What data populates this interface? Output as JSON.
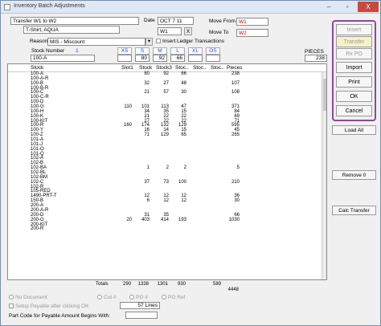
{
  "window": {
    "title": "Inventory Batch Adjustments",
    "close_label": "X",
    "min_label": "–"
  },
  "header": {
    "transfer_desc": "Transfer W1 to W2",
    "item_desc": "T-Shirt, AQUA",
    "date_label": "Date",
    "date_value": "OCT 7 11",
    "warehouse": "W1",
    "move_from_label": "Move From",
    "move_from_value": "W1",
    "move_to_label": "Move To",
    "move_to_value": "W2",
    "x_button": "X"
  },
  "reason": {
    "label": "Reason",
    "value": "MIS - Miscount",
    "insert_ledger_label": "Insert Ledger Transactions"
  },
  "stock_entry": {
    "label": "Stock Number",
    "number": "1",
    "value": "100-A",
    "pieces_label": "PIECES",
    "pieces_value": "238"
  },
  "sizes": [
    "XS",
    "S",
    "M",
    "L",
    "XL",
    "OS"
  ],
  "entry_qtys": [
    "",
    "80",
    "92",
    "66",
    "",
    ""
  ],
  "actions": {
    "insert": "Insert",
    "transfer": "Transfer",
    "rx_po": "Rx PO",
    "import": "Import",
    "print": "Print",
    "ok": "OK",
    "cancel": "Cancel",
    "load_all": "Load All",
    "remove_0": "Remove 0",
    "calc_transfer": "Calc Transfer"
  },
  "grid": {
    "columns": [
      "Stock",
      "Slot1",
      "Stock",
      "Stock3",
      "Stoc..",
      "Stoc..",
      "Stoc..",
      "Pieces"
    ],
    "rows": [
      [
        "100-A",
        "",
        "80",
        "92",
        "66",
        "",
        "",
        "238"
      ],
      [
        "100-A-R",
        "",
        "",
        "",
        "",
        "",
        "",
        ""
      ],
      [
        "100-B",
        "",
        "32",
        "27",
        "48",
        "",
        "",
        "107"
      ],
      [
        "100-B-R",
        "",
        "",
        "",
        "",
        "",
        "",
        ""
      ],
      [
        "100-C",
        "",
        "21",
        "57",
        "30",
        "",
        "",
        "108"
      ],
      [
        "100-C-R",
        "",
        "",
        "",
        "",
        "",
        "",
        ""
      ],
      [
        "100-D",
        "",
        "",
        "",
        "",
        "",
        "",
        ""
      ],
      [
        "100-G",
        "110",
        "101",
        "113",
        "47",
        "",
        "",
        "371"
      ],
      [
        "100-H",
        "",
        "34",
        "35",
        "15",
        "",
        "",
        "84"
      ],
      [
        "100-K",
        "",
        "21",
        "22",
        "22",
        "",
        "",
        "69"
      ],
      [
        "100-KIT",
        "",
        "27",
        "22",
        "22",
        "",
        "",
        "71"
      ],
      [
        "100-R",
        "160",
        "174",
        "132",
        "129",
        "",
        "",
        "595"
      ],
      [
        "100-Y",
        "",
        "16",
        "14",
        "15",
        "",
        "",
        "45"
      ],
      [
        "100-Z",
        "",
        "71",
        "129",
        "65",
        "",
        "",
        "265"
      ],
      [
        "101-A",
        "",
        "",
        "",
        "",
        "",
        "",
        ""
      ],
      [
        "101-J",
        "",
        "",
        "",
        "",
        "",
        "",
        ""
      ],
      [
        "101-O",
        "",
        "",
        "",
        "",
        "",
        "",
        ""
      ],
      [
        "101-Q",
        "",
        "",
        "",
        "",
        "",
        "",
        ""
      ],
      [
        "102-A",
        "",
        "",
        "",
        "",
        "",
        "",
        ""
      ],
      [
        "102-B",
        "",
        "",
        "",
        "",
        "",
        "",
        ""
      ],
      [
        "102-BA",
        "",
        "1",
        "2",
        "2",
        "",
        "",
        "5"
      ],
      [
        "102-BL",
        "",
        "",
        "",
        "",
        "",
        "",
        ""
      ],
      [
        "102-BM",
        "",
        "",
        "",
        "",
        "",
        "",
        ""
      ],
      [
        "102-C",
        "",
        "37",
        "73",
        "100",
        "",
        "",
        "210"
      ],
      [
        "102-R",
        "",
        "",
        "",
        "",
        "",
        "",
        ""
      ],
      [
        "105-RED",
        "",
        "",
        "",
        "",
        "",
        "",
        ""
      ],
      [
        "1490-PRT-T",
        "",
        "12",
        "12",
        "12",
        "",
        "",
        "36"
      ],
      [
        "150-B",
        "",
        "6",
        "12",
        "12",
        "",
        "",
        "30"
      ],
      [
        "200-A",
        "",
        "",
        "",
        "",
        "",
        "",
        ""
      ],
      [
        "200-A-R",
        "",
        "",
        "",
        "",
        "",
        "",
        ""
      ],
      [
        "200-D",
        "",
        "31",
        "35",
        "",
        "",
        "",
        "66"
      ],
      [
        "200-G",
        "20",
        "403",
        "414",
        "193",
        "",
        "",
        "1030"
      ],
      [
        "200-KIT",
        "",
        "",
        "",
        "",
        "",
        "",
        ""
      ],
      [
        "200-R",
        "",
        "",
        "",
        "",
        "",
        "",
        ""
      ]
    ]
  },
  "totals": {
    "label": "Totals",
    "slot1": "290",
    "stock": "1338",
    "stock3": "1301",
    "stoc1": "930",
    "stoc3": "589",
    "pieces": "4448"
  },
  "footer": {
    "no_document": "No Document",
    "cut": "Cut #",
    "po": "PO #",
    "po_ref": "PO Ref",
    "setup_payable": "Setup Payable after clicking OK",
    "lines_value": "57 Lines",
    "part_code_label": "Part Code for Payable Amount Begins With:"
  }
}
